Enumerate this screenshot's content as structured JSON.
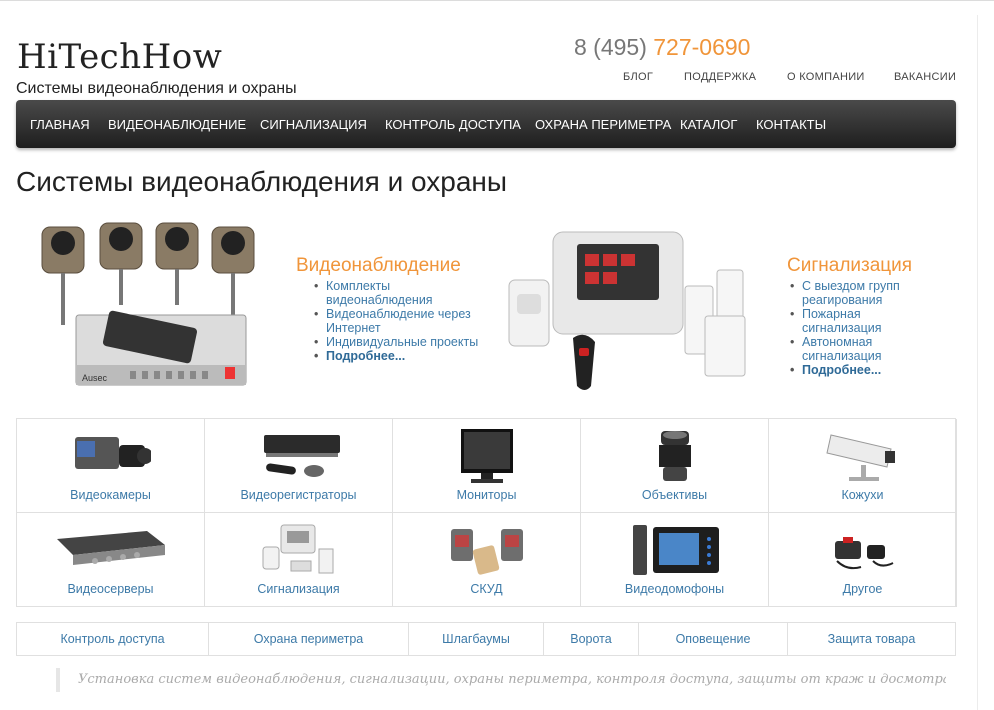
{
  "site": {
    "logo": "HiTechHow",
    "tagline": "Системы видеонаблюдения и охраны",
    "phone_prefix": "8 (495)",
    "phone_number": "727-0690"
  },
  "top_nav": [
    "БЛОГ",
    "ПОДДЕРЖКА",
    "О КОМПАНИИ",
    "ВАКАНСИИ"
  ],
  "main_nav": [
    "ГЛАВНАЯ",
    "ВИДЕОНАБЛЮДЕНИЕ",
    "СИГНАЛИЗАЦИЯ",
    "КОНТРОЛЬ ДОСТУПА",
    "ОХРАНА ПЕРИМЕТРА",
    "КАТАЛОГ",
    "КОНТАКТЫ"
  ],
  "page_title": "Системы видеонаблюдения и охраны",
  "promos": [
    {
      "title": "Видеонаблюдение",
      "items": [
        "Комплекты видеонаблюдения",
        "Видеонаблюдение через Интернет",
        "Индивидуальные проекты"
      ],
      "more": "Подробнее..."
    },
    {
      "title": "Сигнализация",
      "items": [
        "С выездом групп реагирования",
        "Пожарная сигнализация",
        "Автономная сигнализация"
      ],
      "more": "Подробнее..."
    }
  ],
  "categories": [
    {
      "label": "Видеокамеры",
      "icon": "camera-icon"
    },
    {
      "label": "Видеорегистраторы",
      "icon": "dvr-icon"
    },
    {
      "label": "Мониторы",
      "icon": "monitor-icon"
    },
    {
      "label": "Объективы",
      "icon": "lens-icon"
    },
    {
      "label": "Кожухи",
      "icon": "housing-icon"
    },
    {
      "label": "Видеосерверы",
      "icon": "video-server-icon"
    },
    {
      "label": "Сигнализация",
      "icon": "alarm-kit-icon"
    },
    {
      "label": "СКУД",
      "icon": "access-control-icon"
    },
    {
      "label": "Видеодомофоны",
      "icon": "video-intercom-icon"
    },
    {
      "label": "Другое",
      "icon": "other-icon"
    }
  ],
  "sub_nav": [
    "Контроль доступа",
    "Охрана периметра",
    "Шлагбаумы",
    "Ворота",
    "Оповещение",
    "Защита товара"
  ],
  "quote": "Установка систем видеонаблюдения, сигнализации, охраны периметра, контроля доступа, защиты от краж и досмотра",
  "colors": {
    "accent_orange": "#f0953a",
    "link_blue": "#3d7aa8",
    "nav_dark": "#2a2a2a"
  }
}
